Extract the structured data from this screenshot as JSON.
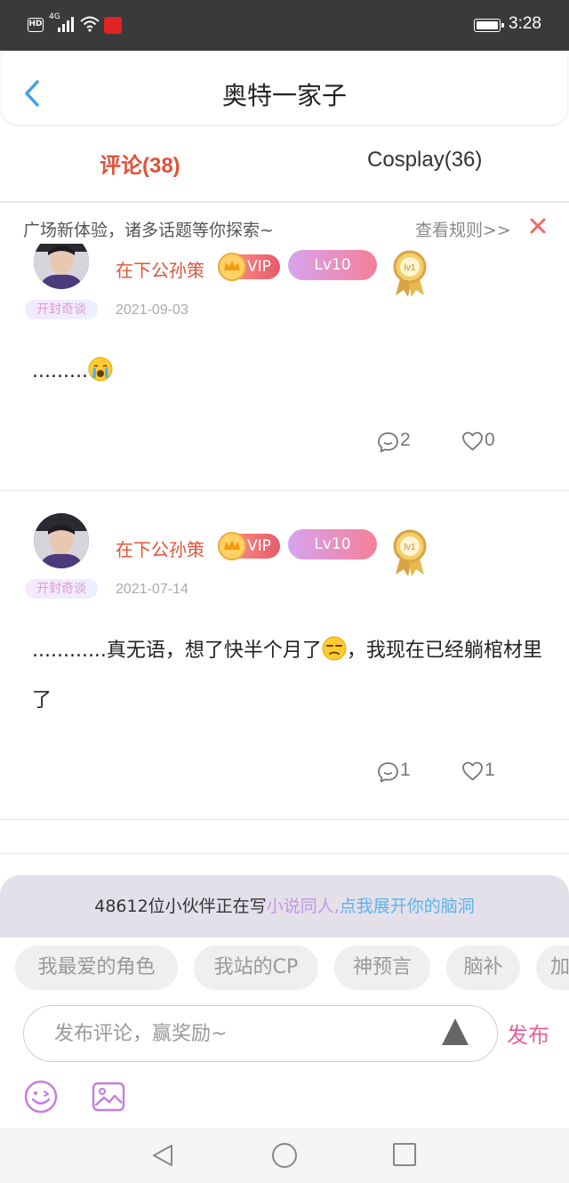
{
  "status_bar": {
    "network_badge": "HD",
    "network_type": "4G",
    "app_badge": "",
    "time": "3:28"
  },
  "header": {
    "title": "奥特一家子"
  },
  "tabs": [
    {
      "label": "评论(38)",
      "active": true
    },
    {
      "label": "Cosplay(36)",
      "active": false
    }
  ],
  "notice": {
    "text": "广场新体验，诸多话题等你探索~",
    "link": "查看规则>>"
  },
  "comments": [
    {
      "username": "在下公孙策",
      "vip_label": "VIP",
      "level": "Lv10",
      "badge": "开封奇谈",
      "medal_label": "lv1",
      "date": "2021-09-03",
      "content": ".........",
      "emoji": "crying-face",
      "replies": "2",
      "likes": "0"
    },
    {
      "username": "在下公孙策",
      "vip_label": "VIP",
      "level": "Lv10",
      "badge": "开封奇谈",
      "medal_label": "lv1",
      "date": "2021-07-14",
      "content_before_emoji": "............真无语，想了快半个月了",
      "emoji": "unamused-face",
      "content_after_emoji": "，我现在已经躺棺材里了",
      "replies": "1",
      "likes": "1"
    }
  ],
  "promo": {
    "prefix": "48612位小伙伴正在写",
    "highlight_1": "小说同人,",
    "highlight_2": "点我展开你的脑洞"
  },
  "topic_chips": [
    "我最爱的角色",
    "我站的CP",
    "神预言",
    "脑补",
    "加"
  ],
  "composer": {
    "placeholder": "发布评论，赢奖励~",
    "publish_label": "发布"
  },
  "colors": {
    "accent_red": "#e0533a",
    "publish_pink": "#e8609a",
    "lv_gradient_start": "#d7a4ef",
    "lv_gradient_end": "#f47f9a",
    "promo_purple": "#c397e5",
    "promo_blue": "#5ab4ea"
  }
}
